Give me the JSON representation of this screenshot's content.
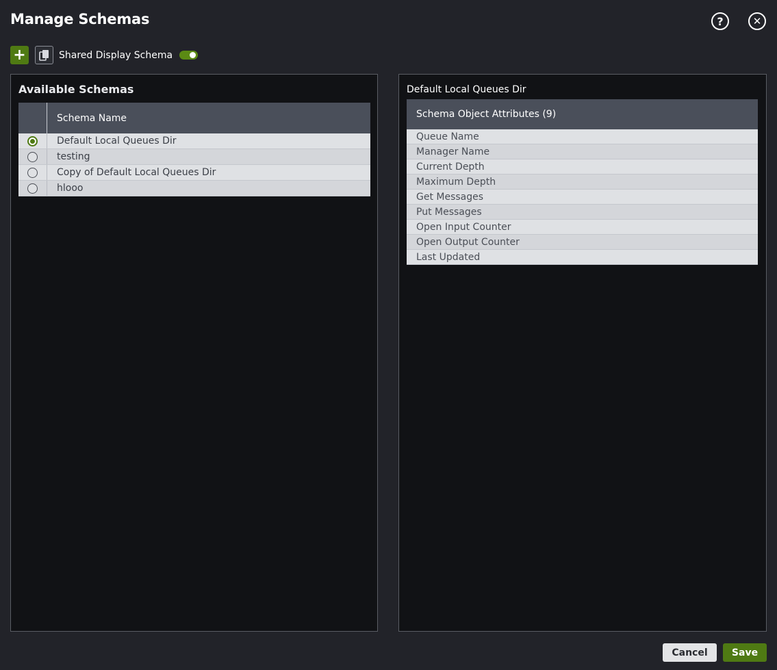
{
  "dialog": {
    "title": "Manage Schemas",
    "help_icon": "help-circle-icon",
    "close_icon": "close-circle-icon"
  },
  "toolbar": {
    "add_icon": "plus-icon",
    "copy_icon": "copy-icon",
    "shared_label": "Shared Display Schema",
    "shared_toggle_on": true
  },
  "available": {
    "title": "Available Schemas",
    "column_header": "Schema Name",
    "rows": [
      {
        "name": "Default Local Queues Dir",
        "selected": true
      },
      {
        "name": "testing",
        "selected": false
      },
      {
        "name": "Copy of Default Local Queues Dir",
        "selected": false
      },
      {
        "name": "hlooo",
        "selected": false
      }
    ]
  },
  "details": {
    "title": "Default Local Queues Dir",
    "column_header": "Schema Object Attributes (9)",
    "attributes": [
      "Queue Name",
      "Manager Name",
      "Current Depth",
      "Maximum Depth",
      "Get Messages",
      "Put Messages",
      "Open Input Counter",
      "Open Output Counter",
      "Last Updated"
    ]
  },
  "footer": {
    "cancel_label": "Cancel",
    "save_label": "Save"
  },
  "colors": {
    "accent": "#4f7a13",
    "background": "#222329",
    "panel": "#111215",
    "header": "#4a4f5a"
  }
}
